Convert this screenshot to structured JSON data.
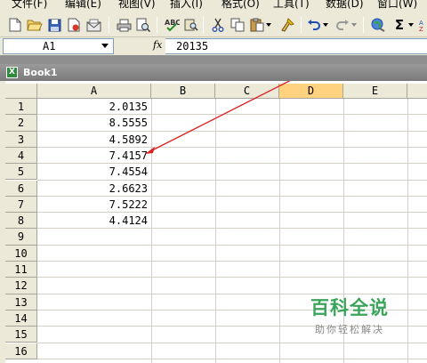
{
  "menubar": {
    "items": [
      {
        "label": "文件(F)"
      },
      {
        "label": "编辑(E)"
      },
      {
        "label": "视图(V)"
      },
      {
        "label": "插入(I)"
      },
      {
        "label": "格式(O)"
      },
      {
        "label": "工具(T)"
      },
      {
        "label": "数据(D)"
      },
      {
        "label": "窗口(W)"
      }
    ]
  },
  "toolbar": {
    "icons": [
      "new-icon",
      "open-icon",
      "save-icon",
      "permission-icon",
      "email-icon",
      "print-icon",
      "print-preview-icon",
      "spelling-icon",
      "research-icon",
      "cut-icon",
      "copy-icon",
      "paste-icon",
      "format-painter-icon",
      "undo-icon",
      "redo-icon",
      "hyperlink-icon",
      "autosum-icon"
    ],
    "autosum_glyph": "Σ"
  },
  "formula_bar": {
    "name_box": "A1",
    "fx_label": "fx",
    "value": "20135"
  },
  "workbook": {
    "title": "Book1"
  },
  "sheet": {
    "columns": [
      "A",
      "B",
      "C",
      "D",
      "E"
    ],
    "rows": [
      "1",
      "2",
      "3",
      "4",
      "5",
      "6",
      "7",
      "8",
      "9",
      "10",
      "11",
      "12",
      "13",
      "14",
      "15",
      "16"
    ],
    "column_a_values": [
      "2.0135",
      "8.5555",
      "4.5892",
      "7.4157",
      "7.4554",
      "2.6623",
      "7.5222",
      "4.4124"
    ],
    "selected_column": "D"
  },
  "annotation": {
    "arrow_color": "#e02020"
  },
  "watermark": {
    "title": "百科全说",
    "subtitle": "助你轻松解决"
  }
}
